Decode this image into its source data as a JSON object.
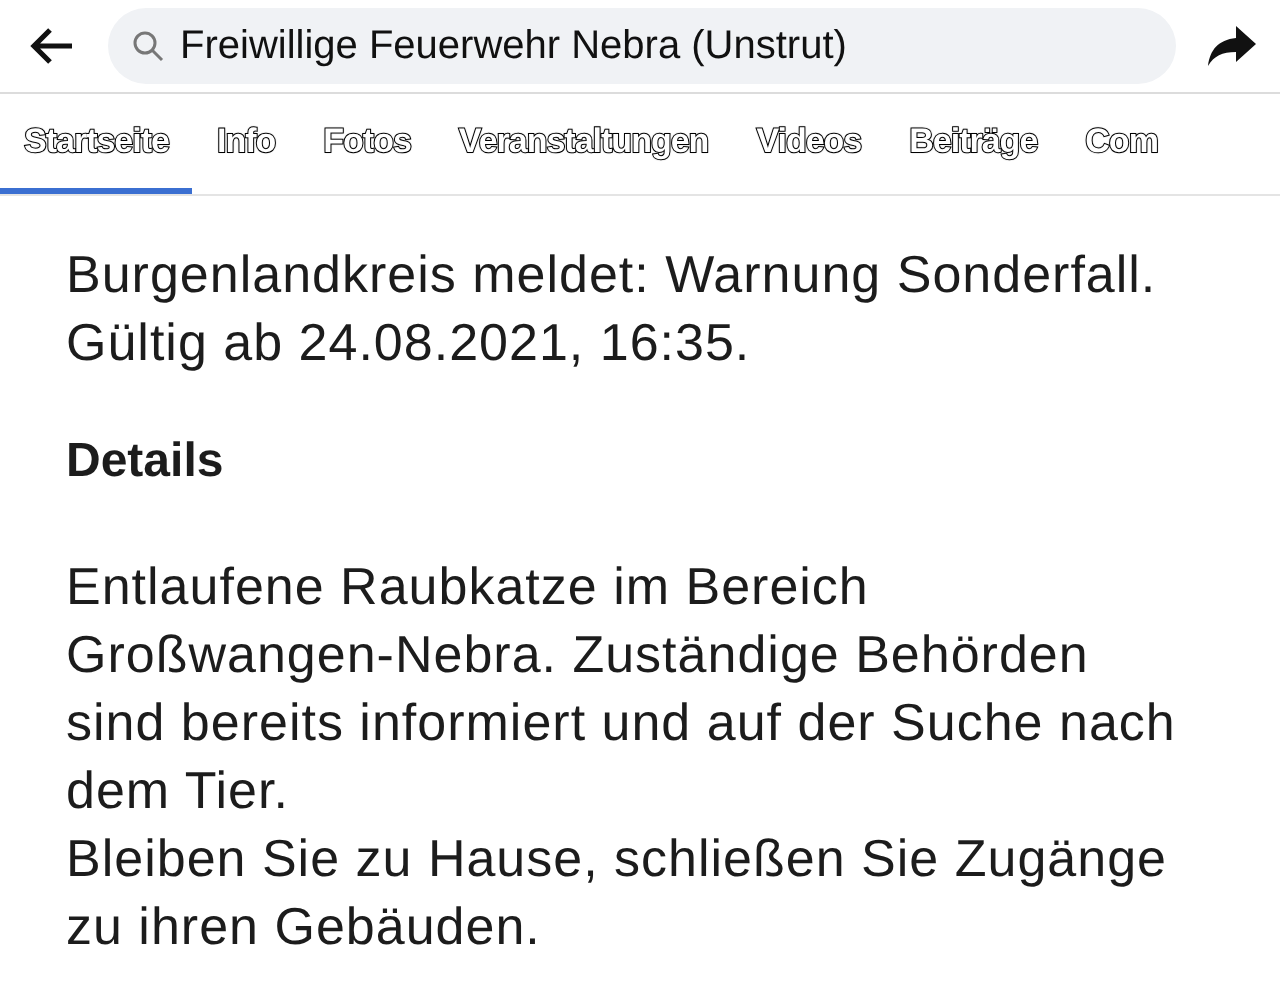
{
  "search": {
    "value": "Freiwillige Feuerwehr Nebra (Unstrut)"
  },
  "tabs": [
    {
      "label": "Startseite",
      "selected": true
    },
    {
      "label": "Info",
      "selected": false
    },
    {
      "label": "Fotos",
      "selected": false
    },
    {
      "label": "Veranstaltungen",
      "selected": false
    },
    {
      "label": "Videos",
      "selected": false
    },
    {
      "label": "Beiträge",
      "selected": false
    },
    {
      "label": "Com",
      "selected": false
    }
  ],
  "post": {
    "intro": "Burgenlandkreis meldet: Warnung Sonderfall. Gültig ab 24.08.2021, 16:35.",
    "heading": "Details",
    "paragraphs": [
      "Entlaufene Raubkatze im Bereich Großwangen-Nebra. Zuständige Behörden sind bereits informiert und auf der Suche nach dem Tier.",
      "Bleiben Sie zu Hause, schließen Sie Zugänge zu ihren Gebäuden."
    ]
  }
}
